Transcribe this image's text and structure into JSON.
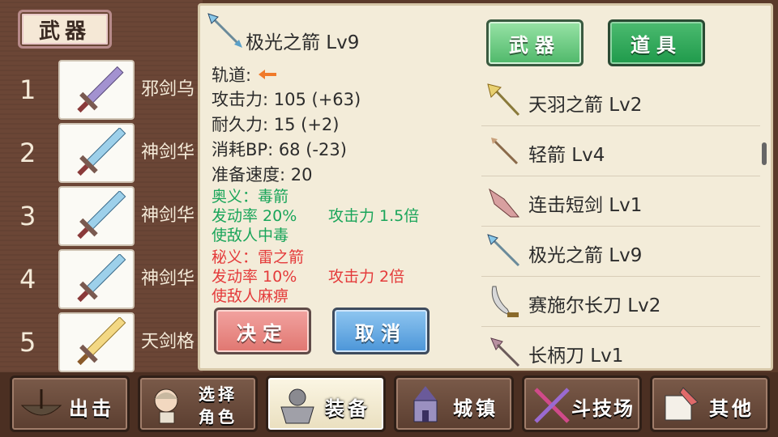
{
  "category_tag": "武器",
  "slots": [
    {
      "num": "1",
      "name": "邪剑乌"
    },
    {
      "num": "2",
      "name": "神剑华"
    },
    {
      "num": "3",
      "name": "神剑华"
    },
    {
      "num": "4",
      "name": "神剑华"
    },
    {
      "num": "5",
      "name": "天剑格"
    }
  ],
  "detail": {
    "title": "极光之箭 Lv9",
    "trajectory_label": "轨道:",
    "attack": "攻击力: 105 (+63)",
    "durability": "耐久力: 15 (+2)",
    "cost": "消耗BP: 68 (-23)",
    "speed": "准备速度: 20",
    "secret1_title": "奥义：毒箭",
    "secret1_rate": "发动率 20%",
    "secret1_power": "攻击力 1.5倍",
    "secret1_effect": "使敌人中毒",
    "secret2_title": "秘义：雷之箭",
    "secret2_rate": "发动率 10%",
    "secret2_power": "攻击力 2倍",
    "secret2_effect": "使敌人麻痹"
  },
  "buttons": {
    "ok": "决定",
    "cancel": "取消"
  },
  "tabs": {
    "weapon": "武器",
    "item": "道具"
  },
  "list": [
    {
      "label": "天羽之箭 Lv2",
      "icon": "golden-arrow-icon"
    },
    {
      "label": "轻箭 Lv4",
      "icon": "light-arrow-icon"
    },
    {
      "label": "连击短剑 Lv1",
      "icon": "short-sword-icon"
    },
    {
      "label": "极光之箭 Lv9",
      "icon": "aurora-arrow-icon"
    },
    {
      "label": "赛施尔长刀 Lv2",
      "icon": "long-blade-icon"
    },
    {
      "label": "长柄刀 Lv1",
      "icon": "glaive-icon"
    }
  ],
  "nav": {
    "sortie": "出击",
    "select_char_1": "选择",
    "select_char_2": "角色",
    "equip": "装备",
    "town": "城镇",
    "arena": "斗技场",
    "other": "其他"
  },
  "colors": {
    "green_text": "#1aa55a",
    "red_text": "#e43b3b",
    "arrow_orange": "#f07a2a"
  }
}
